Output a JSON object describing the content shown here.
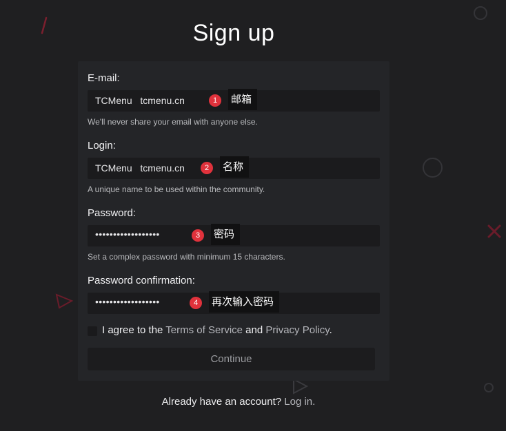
{
  "page": {
    "title": "Sign up"
  },
  "form": {
    "email": {
      "label": "E-mail:",
      "value": "TCMenu   tcmenu.cn",
      "help": "We'll never share your email with anyone else.",
      "badge": "1",
      "annotation": "邮箱"
    },
    "login": {
      "label": "Login:",
      "value": "TCMenu   tcmenu.cn",
      "help": "A unique name to be used within the community.",
      "badge": "2",
      "annotation": "名称"
    },
    "password": {
      "label": "Password:",
      "value": "••••••••••••••••••",
      "help": "Set a complex password with minimum 15 characters.",
      "badge": "3",
      "annotation": "密码"
    },
    "password_confirmation": {
      "label": "Password confirmation:",
      "value": "••••••••••••••••••",
      "badge": "4",
      "annotation": "再次输入密码"
    },
    "agree": {
      "prefix": "I agree to the ",
      "terms_link": "Terms of Service",
      "middle": " and ",
      "privacy_link": "Privacy Policy",
      "suffix": "."
    },
    "continue_label": "Continue"
  },
  "footer": {
    "prompt": "Already have an account? ",
    "login_link": "Log in."
  },
  "colors": {
    "background": "#1f1f21",
    "card": "#242528",
    "input": "#1b1b1d",
    "badge": "#e0323c",
    "decor_red": "#7a1f2e",
    "decor_gray": "#343438"
  }
}
